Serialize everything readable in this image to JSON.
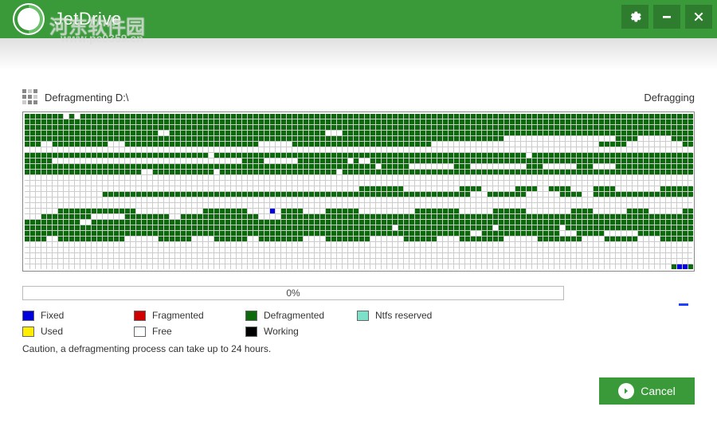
{
  "app": {
    "title": "JetDrive",
    "watermark_text": "河东软件园",
    "watermark_url": "www.pc0359.cn"
  },
  "status": {
    "operation_label": "Defragmenting D:\\",
    "state_label": "Defragging"
  },
  "progress": {
    "text": "0%",
    "value": 0
  },
  "legend": {
    "fixed": "Fixed",
    "fragmented": "Fragmented",
    "defragmented": "Defragmented",
    "ntfs_reserved": "Ntfs reserved",
    "used": "Used",
    "free": "Free",
    "working": "Working"
  },
  "colors": {
    "fixed": "#0000dd",
    "fragmented": "#d00000",
    "defragmented": "#0c6a0c",
    "ntfs_reserved": "#7de0c8",
    "used": "#ffee00",
    "free": "#ffffff",
    "working": "#000000",
    "brand": "#3a9a3a"
  },
  "cancel_label": "Cancel",
  "caution_text": "Caution, a defragmenting process can take up to 24 hours.",
  "grid": {
    "cols": 120,
    "rows": 28,
    "free_runs": [
      [
        0,
        7,
        1
      ],
      [
        0,
        9,
        1
      ],
      [
        3,
        24,
        2
      ],
      [
        3,
        54,
        3
      ],
      [
        4,
        86,
        20
      ],
      [
        4,
        110,
        6
      ],
      [
        5,
        3,
        2
      ],
      [
        5,
        15,
        3
      ],
      [
        5,
        42,
        6
      ],
      [
        5,
        73,
        30
      ],
      [
        5,
        108,
        10
      ],
      [
        6,
        0,
        120
      ],
      [
        7,
        33,
        1
      ],
      [
        7,
        90,
        1
      ],
      [
        8,
        5,
        34
      ],
      [
        8,
        43,
        6
      ],
      [
        8,
        60,
        2
      ],
      [
        8,
        58,
        1
      ],
      [
        9,
        63,
        1
      ],
      [
        9,
        69,
        8
      ],
      [
        9,
        80,
        10
      ],
      [
        9,
        93,
        6
      ],
      [
        9,
        102,
        4
      ],
      [
        10,
        21,
        2
      ],
      [
        10,
        34,
        1
      ],
      [
        10,
        56,
        1
      ],
      [
        11,
        0,
        120
      ],
      [
        12,
        0,
        120
      ],
      [
        13,
        0,
        60
      ],
      [
        13,
        68,
        10
      ],
      [
        13,
        82,
        6
      ],
      [
        13,
        92,
        2
      ],
      [
        13,
        98,
        4
      ],
      [
        13,
        106,
        8
      ],
      [
        14,
        0,
        14
      ],
      [
        14,
        80,
        3
      ],
      [
        14,
        90,
        6
      ],
      [
        14,
        100,
        2
      ],
      [
        15,
        0,
        120
      ],
      [
        16,
        0,
        120
      ],
      [
        17,
        0,
        6
      ],
      [
        17,
        20,
        12
      ],
      [
        17,
        40,
        6
      ],
      [
        17,
        50,
        4
      ],
      [
        17,
        60,
        10
      ],
      [
        17,
        78,
        6
      ],
      [
        17,
        90,
        8
      ],
      [
        17,
        102,
        6
      ],
      [
        17,
        112,
        6
      ],
      [
        18,
        0,
        3
      ],
      [
        18,
        12,
        6
      ],
      [
        18,
        26,
        2
      ],
      [
        18,
        42,
        4
      ],
      [
        19,
        10,
        2
      ],
      [
        20,
        66,
        1
      ],
      [
        20,
        84,
        1
      ],
      [
        20,
        96,
        1
      ],
      [
        21,
        80,
        2
      ],
      [
        21,
        96,
        3
      ],
      [
        21,
        104,
        6
      ],
      [
        22,
        4,
        2
      ],
      [
        22,
        18,
        6
      ],
      [
        22,
        30,
        4
      ],
      [
        22,
        40,
        2
      ],
      [
        22,
        50,
        4
      ],
      [
        22,
        62,
        6
      ],
      [
        22,
        74,
        4
      ],
      [
        22,
        86,
        6
      ],
      [
        22,
        100,
        4
      ],
      [
        22,
        110,
        4
      ],
      [
        23,
        0,
        120
      ],
      [
        24,
        0,
        120
      ],
      [
        25,
        0,
        120
      ],
      [
        26,
        0,
        120
      ],
      [
        27,
        0,
        116
      ]
    ],
    "fixed_cells": [
      [
        17,
        44
      ],
      [
        27,
        117
      ],
      [
        27,
        118
      ]
    ]
  }
}
